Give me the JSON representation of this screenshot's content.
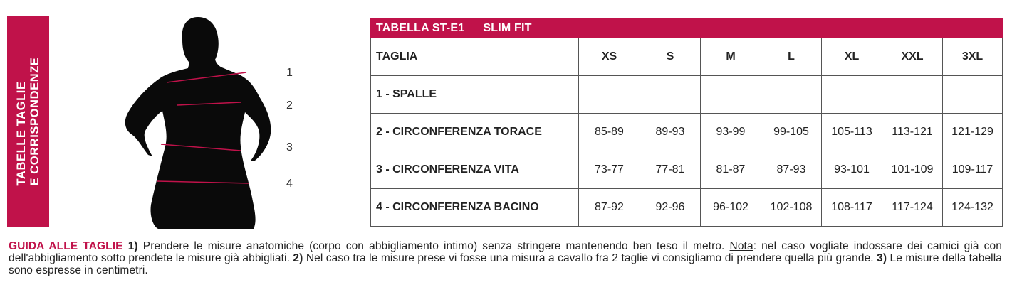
{
  "sidebar": {
    "line1": "TABELLE TAGLIE",
    "line2": "E CORRISPONDENZE"
  },
  "figure": {
    "markers": [
      "1",
      "2",
      "3",
      "4"
    ]
  },
  "table": {
    "title": "TABELLA ST-E1",
    "subtitle": "SLIM FIT",
    "header_label": "TAGLIA",
    "sizes": [
      "XS",
      "S",
      "M",
      "L",
      "XL",
      "XXL",
      "3XL"
    ],
    "rows": [
      {
        "label": "1 - SPALLE",
        "values": [
          "",
          "",
          "",
          "",
          "",
          "",
          ""
        ]
      },
      {
        "label": "2 - CIRCONFERENZA TORACE",
        "values": [
          "85-89",
          "89-93",
          "93-99",
          "99-105",
          "105-113",
          "113-121",
          "121-129"
        ]
      },
      {
        "label": "3 - CIRCONFERENZA VITA",
        "values": [
          "73-77",
          "77-81",
          "81-87",
          "87-93",
          "93-101",
          "101-109",
          "109-117"
        ]
      },
      {
        "label": "4 - CIRCONFERENZA BACINO",
        "values": [
          "87-92",
          "92-96",
          "96-102",
          "102-108",
          "108-117",
          "117-124",
          "124-132"
        ]
      }
    ]
  },
  "guide": {
    "lead": "GUIDA ALLE TAGLIE",
    "n1": "1)",
    "t1": " Prendere le misure anatomiche (corpo con abbigliamento intimo) senza stringere mantenendo ben teso il metro. ",
    "nota": "Nota",
    "t1b": ": nel caso vogliate indossare dei camici già con dell'abbigliamento sotto prendete le misure già abbigliati. ",
    "n2": "2)",
    "t2": " Nel caso tra le misure prese vi fosse una misura a cavallo fra 2 taglie vi consigliamo di prendere quella più grande. ",
    "n3": "3)",
    "t3": " Le misure della tabella sono espresse in centimetri."
  },
  "colors": {
    "accent": "#c0124a",
    "silhouette": "#0a0a0a"
  }
}
